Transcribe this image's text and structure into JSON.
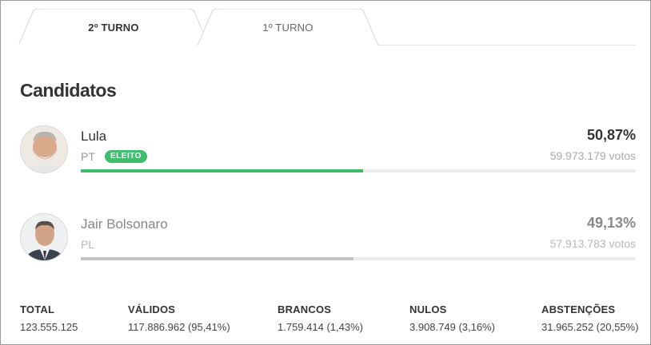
{
  "tabs": [
    {
      "label": "2º TURNO",
      "active": true
    },
    {
      "label": "1º TURNO",
      "active": false
    }
  ],
  "section_title": "Candidatos",
  "candidates": [
    {
      "name": "Lula",
      "party": "PT",
      "badge": "ELEITO",
      "percent": "50,87%",
      "votes": "59.973.179 votos",
      "share": 0.5087,
      "bar_color": "#3fbf6e",
      "avatar": "lula-portrait"
    },
    {
      "name": "Jair Bolsonaro",
      "party": "PL",
      "badge": "",
      "percent": "49,13%",
      "votes": "57.913.783 votos",
      "share": 0.4913,
      "bar_color": "#c4c4c4",
      "avatar": "bolsonaro-portrait"
    }
  ],
  "stats": [
    {
      "label": "TOTAL",
      "value": "123.555.125"
    },
    {
      "label": "VÁLIDOS",
      "value": "117.886.962 (95,41%)"
    },
    {
      "label": "BRANCOS",
      "value": "1.759.414 (1,43%)"
    },
    {
      "label": "NULOS",
      "value": "3.908.749 (3,16%)"
    },
    {
      "label": "ABSTENÇÕES",
      "value": "31.965.252 (20,55%)"
    }
  ],
  "colors": {
    "accent": "#3fbf6e",
    "text": "#333333",
    "muted": "#999999"
  }
}
